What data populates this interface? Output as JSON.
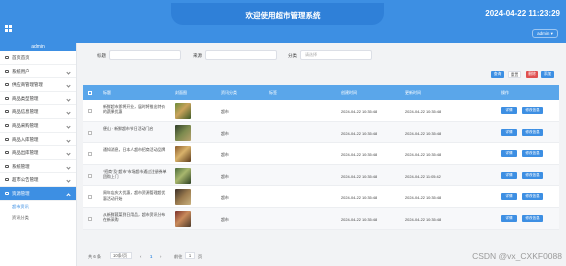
{
  "header": {
    "title": "欢迎使用超市管理系统",
    "datetime": "2024-04-22 11:23:29",
    "user_button": "admin ▾"
  },
  "sidebar": {
    "user": "admin",
    "items": [
      {
        "label": "首页首页",
        "icon": "home-icon"
      },
      {
        "label": "系统用户",
        "icon": "user-icon"
      },
      {
        "label": "供应商管理管理",
        "icon": "truck-icon"
      },
      {
        "label": "商品类型管理",
        "icon": "tag-icon"
      },
      {
        "label": "商品信息管理",
        "icon": "box-icon"
      },
      {
        "label": "商品采购管理",
        "icon": "cart-icon"
      },
      {
        "label": "商品入库管理",
        "icon": "inbox-icon"
      },
      {
        "label": "商品出库管理",
        "icon": "outbox-icon"
      },
      {
        "label": "系统管理",
        "icon": "settings-icon"
      },
      {
        "label": "超市公告管理",
        "icon": "bell-icon"
      },
      {
        "label": "资源管理",
        "icon": "folder-icon"
      }
    ],
    "sub_items": [
      {
        "label": "超市资讯"
      },
      {
        "label": "资讯分类"
      }
    ]
  },
  "search": {
    "title_label": "标题",
    "source_label": "来源",
    "category_label": "分类",
    "category_placeholder": "请选择"
  },
  "buttons": {
    "query": "查询",
    "reset": "重置",
    "delete": "删除",
    "add": "添加"
  },
  "table": {
    "columns": [
      "标题",
      "封面图",
      "资讯分类",
      "标签",
      "创建时间",
      "更新时间",
      "操作"
    ],
    "rows": [
      {
        "title": "新鲜超市即将开业，届时将推出特价的蔬果优惠",
        "category": "超市",
        "created": "2024-04-22 10:35:48",
        "updated": "2024-04-22 10:35:48",
        "detail": "详情",
        "edit": "修改信息"
      },
      {
        "title": "便山 · 新鲜超市节日活动门启",
        "category": "超市",
        "created": "2024-04-22 10:35:48",
        "updated": "2024-04-22 10:35:48",
        "detail": "详情",
        "edit": "修改信息"
      },
      {
        "title": "通知消息，日本人超市招商活动品牌",
        "category": "超市",
        "created": "2024-04-22 10:35:48",
        "updated": "2024-04-22 10:35:48",
        "detail": "详情",
        "edit": "修改信息"
      },
      {
        "title": "“招商”及“超市”市场超市通过注册券单团购上门",
        "category": "超市",
        "created": "2024-04-22 10:35:48",
        "updated": "2024-04-22 11:05:42",
        "detail": "详情",
        "edit": "修改信息"
      },
      {
        "title": "周年店庆大优惠，超市资源管理超优惠活动开始",
        "category": "超市",
        "created": "2024-04-22 10:35:48",
        "updated": "2024-04-22 10:35:48",
        "detail": "详情",
        "edit": "修改信息"
      },
      {
        "title": "从新鲜蔬菜到日用品，超市资讯分布在新采购",
        "category": "超市",
        "created": "2024-04-22 10:35:48",
        "updated": "2024-04-22 10:35:48",
        "detail": "详情",
        "edit": "修改信息"
      }
    ]
  },
  "pagination": {
    "total": "共 6 条",
    "page_size": "10条/页",
    "prev": "‹",
    "page": "1",
    "next": "›",
    "goto_label": "前往",
    "goto_value": "1",
    "goto_suffix": "页"
  },
  "watermark": "CSDN @vx_CXKF0088",
  "colors": {
    "primary": "#3d8fe3",
    "header_row": "#5aa6ea",
    "delete": "#e05050"
  }
}
